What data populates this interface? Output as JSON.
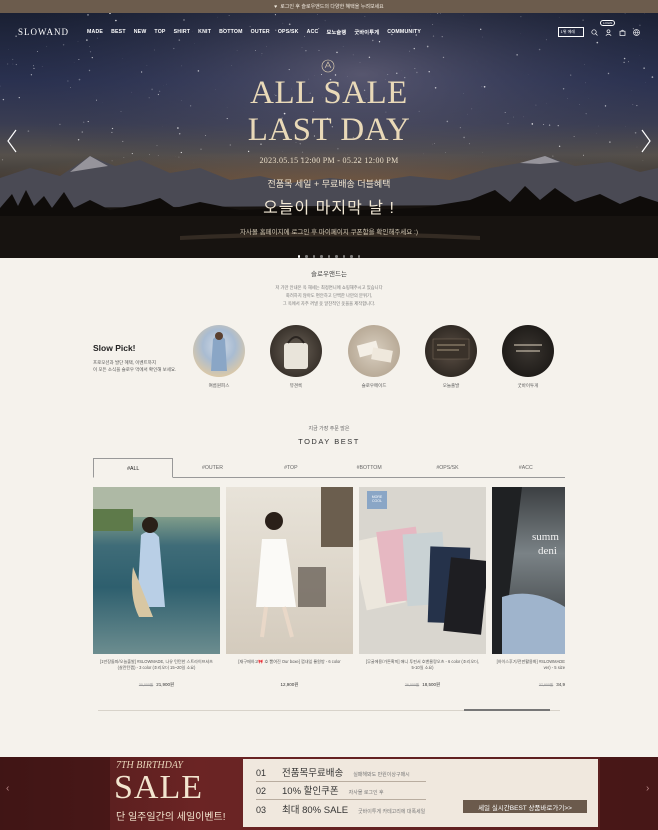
{
  "topbar": {
    "icon": "heart-icon",
    "text": "로그인 후 슬로우앤드의 다양한 혜택을 누려보세요"
  },
  "nav": {
    "logo": "SLOWAND",
    "menu": [
      "MADE",
      "BEST",
      "NEW",
      "TOP",
      "SHIRT",
      "KNIT",
      "BOTTOM",
      "OUTER",
      "OPS/SK",
      "ACC",
      "모노슬랭",
      "굿바이투게",
      "COMMUNITY"
    ],
    "language": "1위 에레",
    "login_tag": "LOGIN",
    "icons": [
      "search-icon",
      "user-icon",
      "bag-icon",
      "globe-icon"
    ]
  },
  "hero": {
    "title_line1": "ALL SALE",
    "title_line2": "LAST DAY",
    "date": "2023.05.15 12:00 PM - 05.22 12:00 PM",
    "sub": "전품목 세일 + 무료배송 더블혜택",
    "big": "오늘이 마지막 날 !",
    "note": "자사몰 홈페이지에 로그인 후 마이페이지 쿠폰함을 확인해주세요 :)",
    "slide_count": 9,
    "active_slide": 0
  },
  "intro": {
    "title": "슬로우앤드는",
    "lines": [
      "저 가만 안내온 옥 해세는 최정면니에 쇼핑해주시고 있습니다",
      "화려하지 않아도 편안하고 단백한 나만의 분위기,",
      "그 옥에서 자주 꺼낼 옷 알찬적인 옷을을 제작합니다."
    ]
  },
  "slow_pick": {
    "title": "Slow Pick!",
    "desc_lines": [
      "프로모션과 발단 혜택, 이벤트까지",
      "이 모든 소식을 슬로우 먹에서 확인해 보세요."
    ],
    "items": [
      {
        "label": "여름원피스"
      },
      {
        "label": "뷰견룩"
      },
      {
        "label": "슬로우메이드"
      },
      {
        "label": "오늘출발"
      },
      {
        "label": "굿바이투게"
      }
    ]
  },
  "best": {
    "sub": "지금 가장 주문 많은",
    "title": "TODAY BEST",
    "tabs": [
      "#ALL",
      "#OUTER",
      "#TOP",
      "#BOTTOM",
      "#OPS/SK",
      "#ACC"
    ],
    "active_tab": 0,
    "products": [
      {
        "desc": [
          "[1만장돌파/오늘출발] #SLOWMADE, 나유 턴턴한 스트라이프셔츠",
          "(살란턴깸) - 3 color (조리오더 15~20일 소요)"
        ],
        "old": "30,000원",
        "price": "21,900원"
      },
      {
        "desc": [
          "[재구매하고🎀 호 뽐여진 Our boxe] 껍내잎 롱원방 - 6 color",
          ""
        ],
        "old": "",
        "price": "12,900원"
      },
      {
        "desc": [
          "[무굴에용/가튼확끼] 애니 투핀서 호밴뮬랑오츠 - 6 color (조리오더,",
          "5-10일 소요)"
        ],
        "old": "26,000원",
        "price": "18,500원"
      },
      {
        "desc": [
          "[하이스후기/전판활용화] #SLOWMADE",
          "ver) - 5 size"
        ],
        "old": "37,900원",
        "price": "34,9"
      }
    ],
    "product4_overlay": [
      "summ",
      "deni"
    ],
    "product3_badge": "MORE COOL"
  },
  "banner": {
    "line1": "7TH BIRTHDAY",
    "sale": "SALE",
    "line3": "단 일주일간의 세일이벤트!",
    "rows": [
      {
        "num": "01",
        "main": "전품목무료배송",
        "small": "실패해봐도 만원이상구매시"
      },
      {
        "num": "02",
        "main": "10% 할인쿠폰",
        "small": "자사몰 로그인 후"
      },
      {
        "num": "03",
        "main": "최대 80% SALE",
        "small": "굿바이투게 카테고리에 대폭세일"
      }
    ],
    "button": "세일 실시간BEST 상품바로가기>>"
  }
}
